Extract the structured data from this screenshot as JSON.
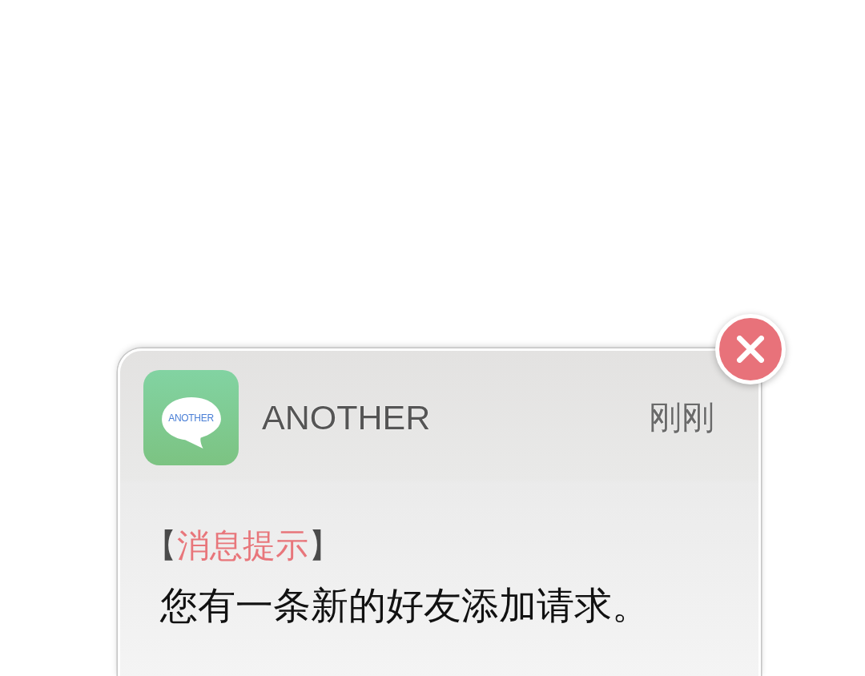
{
  "notification": {
    "app": {
      "icon_label": "ANOTHER",
      "name": "ANOTHER"
    },
    "time": "刚刚",
    "tag": {
      "open": "【",
      "label": "消息提示",
      "close": "】"
    },
    "message": "您有一条新的好友添加请求。"
  }
}
